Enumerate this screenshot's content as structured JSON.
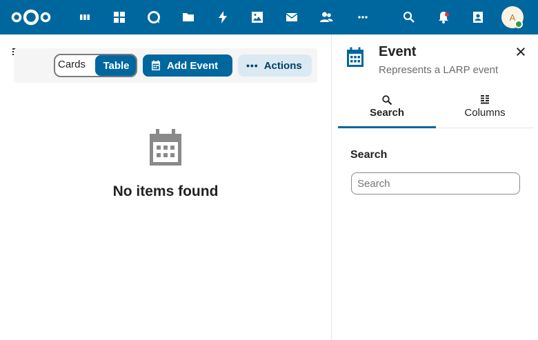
{
  "topbar": {
    "apps": [
      "dashboard-icon",
      "apps-icon",
      "talk-icon",
      "files-icon",
      "activity-icon",
      "photos-icon",
      "mail-icon",
      "contacts-icon",
      "more-icon"
    ],
    "right": [
      "search-icon",
      "notifications-icon",
      "contacts-menu-icon"
    ],
    "avatar_initial": "A",
    "brand_color": "#00679e"
  },
  "toolbar": {
    "view_cards": "Cards",
    "view_table": "Table",
    "add_event": "Add Event",
    "actions": "Actions"
  },
  "main": {
    "empty_text": "No items found"
  },
  "sidebar": {
    "title": "Event",
    "subtitle": "Represents a LARP event",
    "tabs": [
      {
        "label": "Search",
        "active": true
      },
      {
        "label": "Columns",
        "active": false
      }
    ],
    "search_label": "Search",
    "search_placeholder": "Search"
  }
}
